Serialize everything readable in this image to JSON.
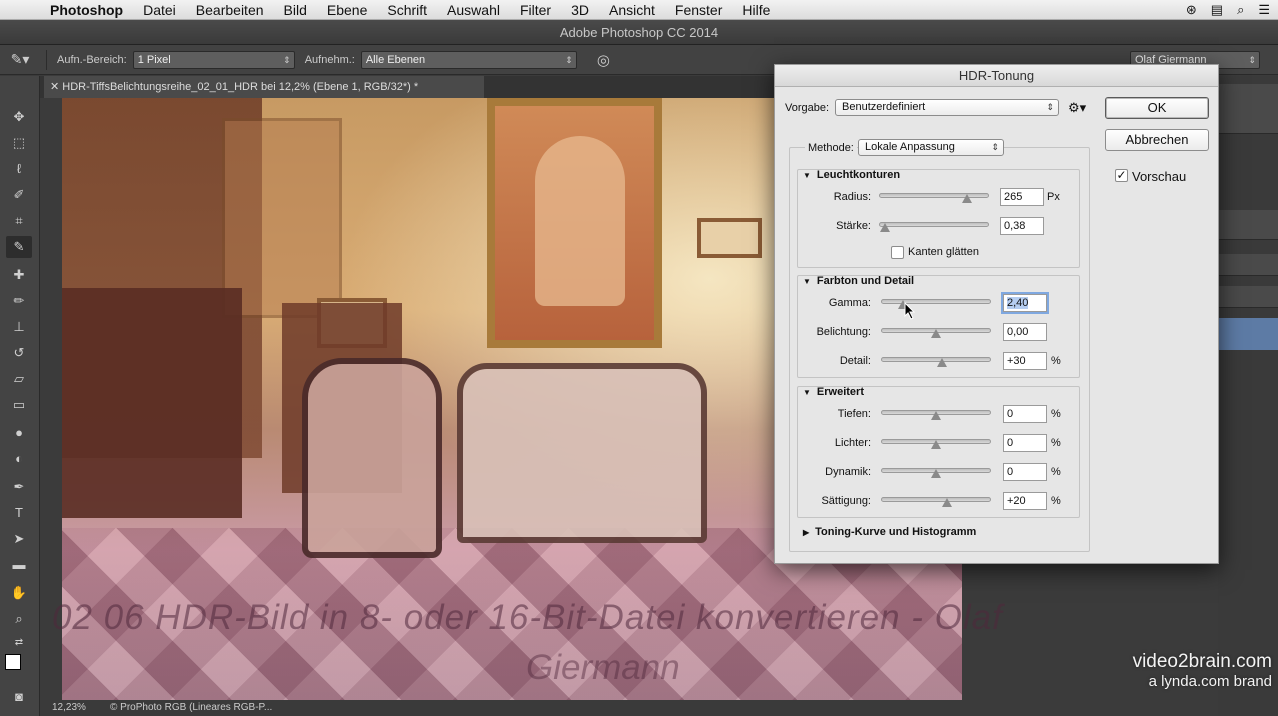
{
  "menubar": {
    "app": "Photoshop",
    "items": [
      "Datei",
      "Bearbeiten",
      "Bild",
      "Ebene",
      "Schrift",
      "Auswahl",
      "Filter",
      "3D",
      "Ansicht",
      "Fenster",
      "Hilfe"
    ]
  },
  "window": {
    "title": "Adobe Photoshop CC 2014"
  },
  "options": {
    "sample_size_label": "Aufn.-Bereich:",
    "sample_size_value": "1 Pixel",
    "sample_label": "Aufnehm.:",
    "sample_value": "Alle Ebenen",
    "user": "Olaf Giermann"
  },
  "document": {
    "tab_title": "HDR-TiffsBelichtungsreihe_02_01_HDR bei 12,2% (Ebene 1, RGB/32*) *",
    "zoom": "12,23%",
    "profile": "ProPhoto RGB (Lineares RGB-P..."
  },
  "watermark": {
    "line1": "02 06 HDR-Bild in 8- oder 16-Bit-Datei konvertieren - Olaf",
    "line2": "Giermann"
  },
  "brand": {
    "line1": "video2brain.com",
    "line2": "a lynda.com brand"
  },
  "dialog": {
    "title": "HDR-Tonung",
    "preset_label": "Vorgabe:",
    "preset_value": "Benutzerdefiniert",
    "method_label": "Methode:",
    "method_value": "Lokale Anpassung",
    "ok": "OK",
    "cancel": "Abbrechen",
    "preview_label": "Vorschau",
    "preview_checked": true,
    "edge_glow": {
      "title": "Leuchtkonturen",
      "radius_label": "Radius:",
      "radius_value": "265",
      "radius_unit": "Px",
      "radius_pos": 0.8,
      "strength_label": "Stärke:",
      "strength_value": "0,38",
      "strength_pos": 0.05,
      "smooth_label": "Kanten glätten"
    },
    "tone_detail": {
      "title": "Farbton und Detail",
      "gamma_label": "Gamma:",
      "gamma_value": "2,40",
      "gamma_pos": 0.2,
      "exposure_label": "Belichtung:",
      "exposure_value": "0,00",
      "exposure_pos": 0.5,
      "detail_label": "Detail:",
      "detail_value": "+30",
      "detail_pos": 0.55
    },
    "advanced": {
      "title": "Erweitert",
      "shadow_label": "Tiefen:",
      "shadow_value": "0",
      "shadow_pos": 0.5,
      "highlight_label": "Lichter:",
      "highlight_value": "0",
      "highlight_pos": 0.5,
      "vibrance_label": "Dynamik:",
      "vibrance_value": "0",
      "vibrance_pos": 0.5,
      "saturation_label": "Sättigung:",
      "saturation_value": "+20",
      "saturation_pos": 0.6
    },
    "curve_title": "Toning-Kurve und Histogramm",
    "percent": "%"
  }
}
